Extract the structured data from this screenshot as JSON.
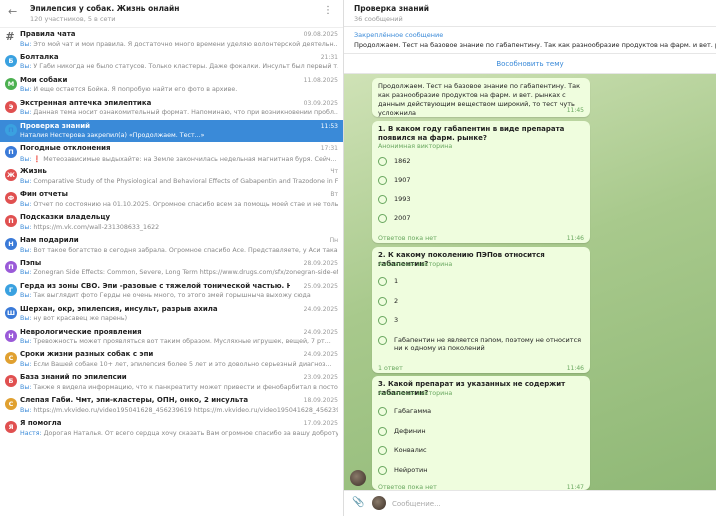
{
  "group": {
    "title": "Эпилепсия у собак. Жизнь онлайн",
    "subtitle": "120 участников, 5 в сети"
  },
  "topics": [
    {
      "icon": "#",
      "color": "",
      "title": "Правила чата",
      "time": "09.08.2025",
      "you": "Вы:",
      "preview": " Это мой чат и мои правила. Я достаточно много времени уделяю волонтерской деятельн..."
    },
    {
      "icon": "Б",
      "color": "#3aa1e0",
      "title": "Болталка",
      "time": "21:31",
      "you": "Вы:",
      "preview": " У Габи никогда не было статусов. Только кластеры. Даже фокалки. Инсульт был первый т..."
    },
    {
      "icon": "М",
      "color": "#4cb050",
      "title": "Мои собаки",
      "time": "11.08.2025",
      "you": "Вы:",
      "preview": " И еще остается Бойка. Я попробую найти его фото в архиве."
    },
    {
      "icon": "Э",
      "color": "#e05050",
      "title": "Экстренная аптечка эпилептика",
      "time": "03.09.2025",
      "you": "Вы:",
      "preview": " Данная тема носит ознакомительный формат. Напоминаю, что при возникновении пробл..."
    },
    {
      "icon": "П",
      "color": "#3aa1e0",
      "title": "Проверка знаний",
      "time": "11:53",
      "you": "",
      "preview": "Наталия Нестерова закрепил(а) «Продолжаем. Тест...»"
    },
    {
      "icon": "П",
      "color": "#3a7ad8",
      "title": "Погодные отклонения",
      "time": "17:31",
      "you": "Вы:",
      "preview": " ❗ Метеозависимые выдыхайте: на Земле закончилась недельная магнитная буря. Сейч..."
    },
    {
      "icon": "Ж",
      "color": "#e05050",
      "title": "Жизнь",
      "time": "Чт",
      "you": "Вы:",
      "preview": " Comparative Study of the Physiological and Behavioral Effects of Gabapentin and Trazodone in Frac..."
    },
    {
      "icon": "Ф",
      "color": "#e05050",
      "title": "Фин отчеты",
      "time": "Вт",
      "you": "Вы:",
      "preview": " Отчет по состоянию на 01.10.2025. Огромное спасибо всем за помощь моей стае и не толь..."
    },
    {
      "icon": "П",
      "color": "#e05050",
      "title": "Подсказки владельцу",
      "time": "",
      "you": "Вы:",
      "preview": " https://m.vk.com/wall-231308633_1622"
    },
    {
      "icon": "Н",
      "color": "#3a7ad8",
      "title": "Нам подарили",
      "time": "Пн",
      "you": "Вы:",
      "preview": " Вот такое богатство в сегодня забрала. Огромное спасибо Асе. Представляете, у Аси така..."
    },
    {
      "icon": "П",
      "color": "#9a5ad8",
      "title": "Пэпы",
      "time": "28.09.2025",
      "you": "Вы:",
      "preview": " Zonegran Side Effects: Common, Severe, Long Term https://www.drugs.com/sfx/zonegran-side-effect..."
    },
    {
      "icon": "Г",
      "color": "#3aa1e0",
      "title": "Герда из зоны СВО. Эпи -разовые с тяжелой тонической частью. Неврологическ...",
      "time": "25.09.2025",
      "you": "Вы:",
      "preview": " Так выглядит фото Герды не очень много, то этого змей горышныча выхожу сюда"
    },
    {
      "icon": "Ш",
      "color": "#3a7ad8",
      "title": "Шерхан, окр, эпилепсия, инсульт, разрыв ахила",
      "time": "24.09.2025",
      "you": "Вы:",
      "preview": " ну вот красавец же парень)"
    },
    {
      "icon": "Н",
      "color": "#9a5ad8",
      "title": "Неврологические проявления",
      "time": "24.09.2025",
      "you": "Вы:",
      "preview": " Тревожность может проявляться вот таким образом. Мусляхные игрушек, вещей, 7 рт..."
    },
    {
      "icon": "С",
      "color": "#e0a030",
      "title": "Сроки жизни разных собак с эпи",
      "time": "24.09.2025",
      "you": "Вы:",
      "preview": " Если Вашей собаке 10+ лет, эпилепсия более 5 лет и это довольно серьезный диагноз..."
    },
    {
      "icon": "Б",
      "color": "#e05050",
      "title": "База знаний по эпилепсии",
      "time": "23.09.2025",
      "you": "Вы:",
      "preview": " Также я видела информацию, что к панкреатиту может привести и фенобарбитал в постоянно..."
    },
    {
      "icon": "С",
      "color": "#e0a030",
      "title": "Слепая Габи. Чмт, эпи-кластеры, ОПН, онко, 2 инсульта",
      "time": "18.09.2025",
      "you": "Вы:",
      "preview": " https://m.vkvideo.ru/video195041628_456239619 https://m.vkvideo.ru/video195041628_456239607"
    },
    {
      "icon": "Я",
      "color": "#e05050",
      "title": "Я помогла",
      "time": "17.09.2025",
      "you": "Настя:",
      "preview": " Дорогая Наталья. От всего сердца хочу сказать Вам огромное спасибо за вашу доброту..."
    }
  ],
  "chat": {
    "title": "Проверка знаний",
    "subtitle": "36 сообщений",
    "pinned_label": "Закреплённое сообщение",
    "pinned_text": "Продолжаем. Тест на базовое знание по габапентину. Так как разнообразие продуктов на фарм. и вет. рынках с д",
    "topic_link": "Вособновить тему",
    "intro": {
      "text": "Продолжаем. Тест на базовое знание по габапентину. Так как разнообразие продуктов на фарм. и вет. рынках с данным действующим веществом широкий, то тест чуть усложнила",
      "time": "11:45"
    },
    "polls": [
      {
        "question": "1. В каком году габапентин в виде препарата появился на фарм. рынке?",
        "anon": "Анонимная викторина",
        "options": [
          "1862",
          "1907",
          "1993",
          "2007"
        ],
        "footer": "Ответов пока нет",
        "time": "11:46"
      },
      {
        "question": "2. К какому поколению ПЭПов относится габапентин?",
        "anon": "Анонимная викторина",
        "options": [
          "1",
          "2",
          "3",
          "Габапентин не является пэпом, поэтому не относится ни к одному из поколений"
        ],
        "footer": "1 ответ",
        "time": "11:46"
      },
      {
        "question": "3. Какой препарат из указанных не содержит габапентин?",
        "anon": "Анонимная викторина",
        "options": [
          "Габагамма",
          "Дефинин",
          "Конвалис",
          "Нейротин"
        ],
        "footer": "Ответов пока нет",
        "time": "11:47"
      }
    ],
    "composer_placeholder": "Сообщение..."
  }
}
